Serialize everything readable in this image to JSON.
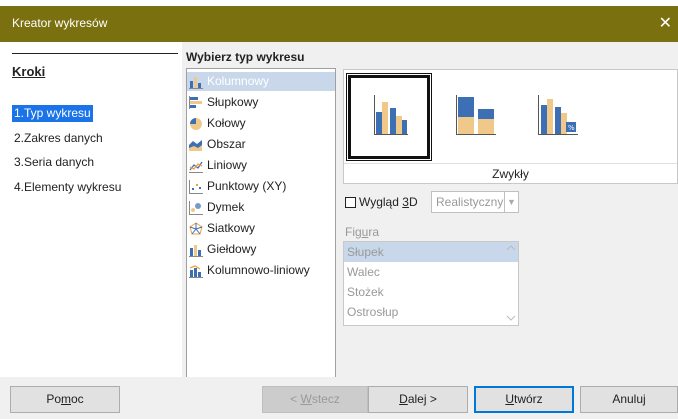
{
  "window": {
    "title": "Kreator wykresów",
    "close_glyph": "✕"
  },
  "steps": {
    "title": "Kroki",
    "items": [
      {
        "label": "1.Typ wykresu",
        "active": true
      },
      {
        "label": "2.Zakres danych",
        "active": false
      },
      {
        "label": "3.Seria danych",
        "active": false
      },
      {
        "label": "4.Elementy wykresu",
        "active": false
      }
    ]
  },
  "chart_type": {
    "heading": "Wybierz typ wykresu",
    "types": [
      {
        "label": "Kolumnowy",
        "icon": "column-chart-icon",
        "selected": true
      },
      {
        "label": "Słupkowy",
        "icon": "bar-chart-icon",
        "selected": false
      },
      {
        "label": "Kołowy",
        "icon": "pie-chart-icon",
        "selected": false
      },
      {
        "label": "Obszar",
        "icon": "area-chart-icon",
        "selected": false
      },
      {
        "label": "Liniowy",
        "icon": "line-chart-icon",
        "selected": false
      },
      {
        "label": "Punktowy (XY)",
        "icon": "scatter-chart-icon",
        "selected": false
      },
      {
        "label": "Dymek",
        "icon": "bubble-chart-icon",
        "selected": false
      },
      {
        "label": "Siatkowy",
        "icon": "net-chart-icon",
        "selected": false
      },
      {
        "label": "Giełdowy",
        "icon": "stock-chart-icon",
        "selected": false
      },
      {
        "label": "Kolumnowo-liniowy",
        "icon": "column-line-chart-icon",
        "selected": false
      }
    ]
  },
  "gallery": {
    "variants": [
      {
        "name": "normal-column-variant",
        "selected": true
      },
      {
        "name": "stacked-column-variant",
        "selected": false
      },
      {
        "name": "percent-stacked-column-variant",
        "selected": false,
        "badge": "%"
      }
    ],
    "caption": "Zwykły"
  },
  "options": {
    "look3d": {
      "label_pre": "Wygląd ",
      "label_key": "3",
      "label_post": "D",
      "checked": false
    },
    "look3d_style": "Realistyczny",
    "figura": {
      "label_pre": "Fig",
      "label_key": "u",
      "label_post": "ra"
    },
    "shapes": [
      {
        "label": "Słupek",
        "selected": true
      },
      {
        "label": "Walec",
        "selected": false
      },
      {
        "label": "Stożek",
        "selected": false
      },
      {
        "label": "Ostrosłup",
        "selected": false
      }
    ]
  },
  "buttons": {
    "help": {
      "pre": "Po",
      "key": "m",
      "post": "oc"
    },
    "back": {
      "pre": "< ",
      "key": "W",
      "post": "stecz"
    },
    "next": {
      "pre": "",
      "key": "D",
      "post": "alej >"
    },
    "create": {
      "pre": "",
      "key": "U",
      "post": "twórz"
    },
    "cancel": "Anuluj"
  },
  "colors": {
    "titlebar": "#7a7010",
    "blue": "#3d6fb5",
    "orange": "#f0c98a",
    "selection": "#c8d8ea",
    "accent": "#1a73e8"
  }
}
